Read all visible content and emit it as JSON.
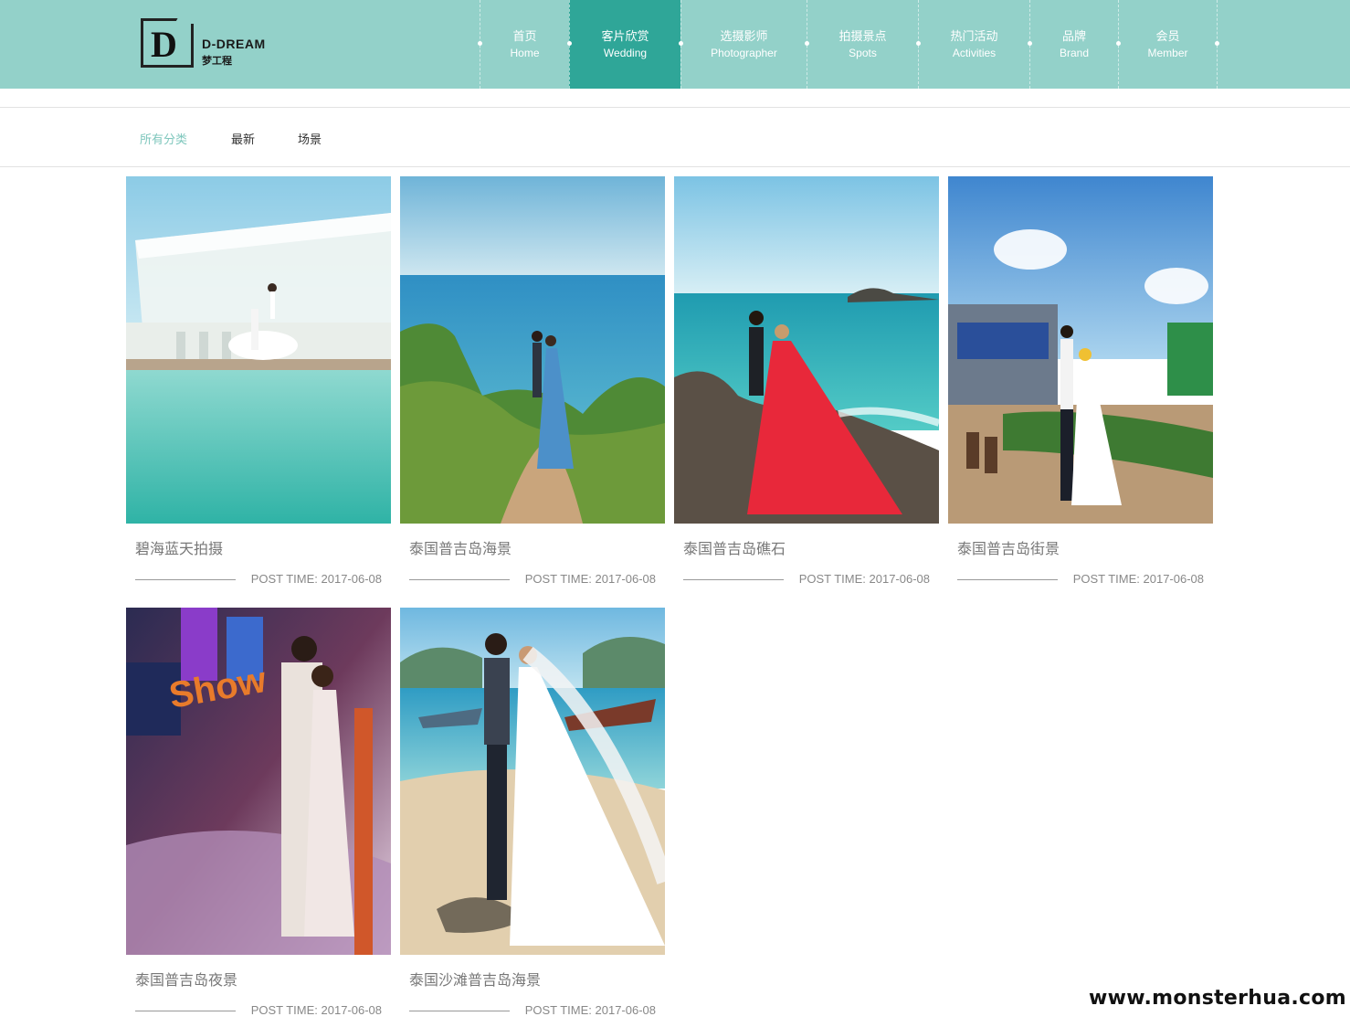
{
  "logo": {
    "letter": "D",
    "name_en": "D-DREAM",
    "name_cn": "梦工程"
  },
  "nav": [
    {
      "cn": "首页",
      "en": "Home",
      "active": false
    },
    {
      "cn": "客片欣赏",
      "en": "Wedding",
      "active": true
    },
    {
      "cn": "选摄影师",
      "en": "Photographer",
      "active": false
    },
    {
      "cn": "拍摄景点",
      "en": "Spots",
      "active": false
    },
    {
      "cn": "热门活动",
      "en": "Activities",
      "active": false
    },
    {
      "cn": "品牌",
      "en": "Brand",
      "active": false
    },
    {
      "cn": "会员",
      "en": "Member",
      "active": false
    }
  ],
  "filters": [
    {
      "label": "所有分类",
      "active": true
    },
    {
      "label": "最新",
      "active": false
    },
    {
      "label": "场景",
      "active": false
    }
  ],
  "cards": [
    {
      "title": "碧海蓝天拍摄",
      "time": "POST TIME: 2017-06-08",
      "scene": "pool"
    },
    {
      "title": "泰国普吉岛海景",
      "time": "POST TIME: 2017-06-08",
      "scene": "cliff"
    },
    {
      "title": "泰国普吉岛礁石",
      "time": "POST TIME: 2017-06-08",
      "scene": "rocks"
    },
    {
      "title": "泰国普吉岛街景",
      "time": "POST TIME: 2017-06-08",
      "scene": "street"
    },
    {
      "title": "泰国普吉岛夜景",
      "time": "POST TIME: 2017-06-08",
      "scene": "night"
    },
    {
      "title": "泰国沙滩普吉岛海景",
      "time": "POST TIME: 2017-06-08",
      "scene": "beach"
    }
  ],
  "watermark": "www.monsterhua.com",
  "colors": {
    "header": "#93d1c9",
    "nav_active": "#2fa698",
    "filter_active": "#7fc7bd"
  }
}
